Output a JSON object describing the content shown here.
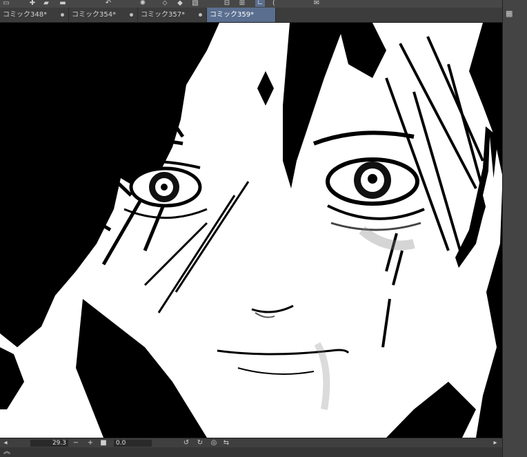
{
  "tabs": [
    {
      "label": "コミック348*",
      "active": false
    },
    {
      "label": "コミック354*",
      "active": false
    },
    {
      "label": "コミック357*",
      "active": false
    },
    {
      "label": "コミック359*",
      "active": true
    }
  ],
  "status": {
    "zoom": "29.3",
    "rotation": "0.0"
  },
  "colors": {
    "accent": "#5a6e8f",
    "panel": "#3c3c3c"
  }
}
